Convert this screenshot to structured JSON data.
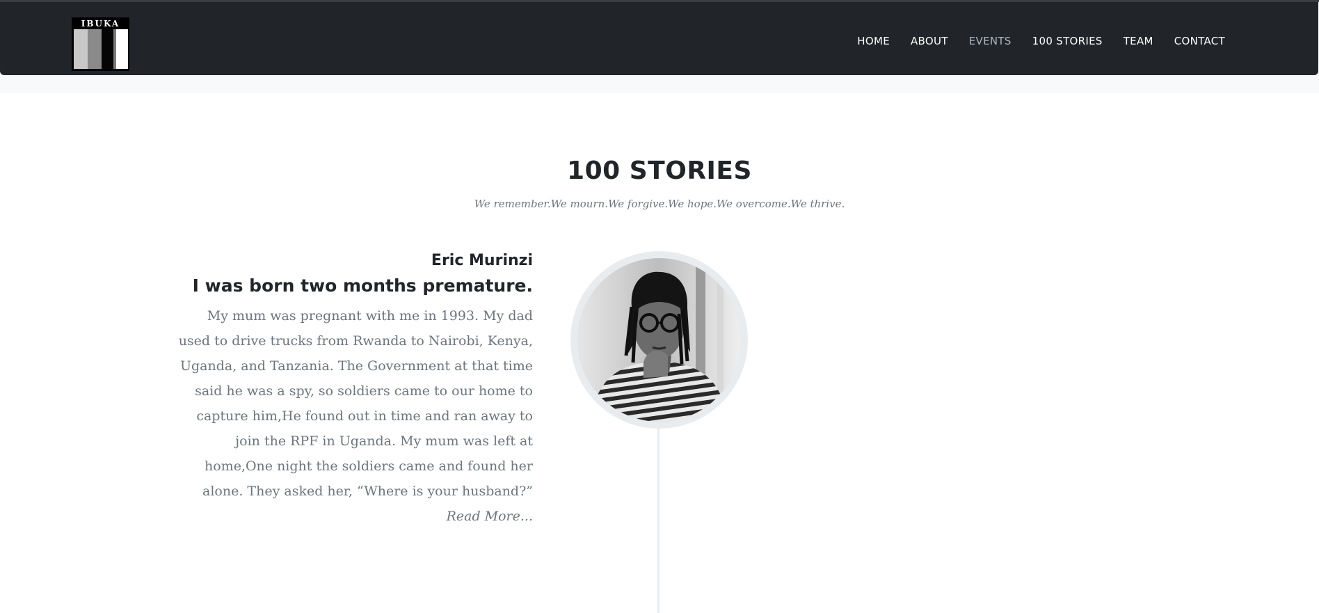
{
  "brand": {
    "logo_text": "IBUKA",
    "colors": {
      "navbar": "#212529",
      "muted_nav": "#adb5bd",
      "body_text": "#6c757d",
      "heading": "#212529"
    }
  },
  "nav": {
    "items": [
      {
        "label": "HOME"
      },
      {
        "label": "ABOUT"
      },
      {
        "label": "EVENTS"
      },
      {
        "label": "100 STORIES"
      },
      {
        "label": "TEAM"
      },
      {
        "label": "CONTACT"
      }
    ]
  },
  "section": {
    "title": "100 STORIES",
    "subtitle": "We remember.We mourn.We forgive.We hope.We overcome.We thrive."
  },
  "story": {
    "name": "Eric Murinzi",
    "heading": "I was born two months premature.",
    "text": "My mum was pregnant with me in 1993. My dad used to drive trucks from Rwanda to Nairobi, Kenya, Uganda, and Tanzania. The Government at that time said he was a spy, so soldiers came to our home to capture him,He found out in time and ran away to join the RPF in Uganda. My mum was left at home,One night the soldiers came and found her alone. They asked her, “Where is your husband?”",
    "read_more": "Read More..."
  }
}
